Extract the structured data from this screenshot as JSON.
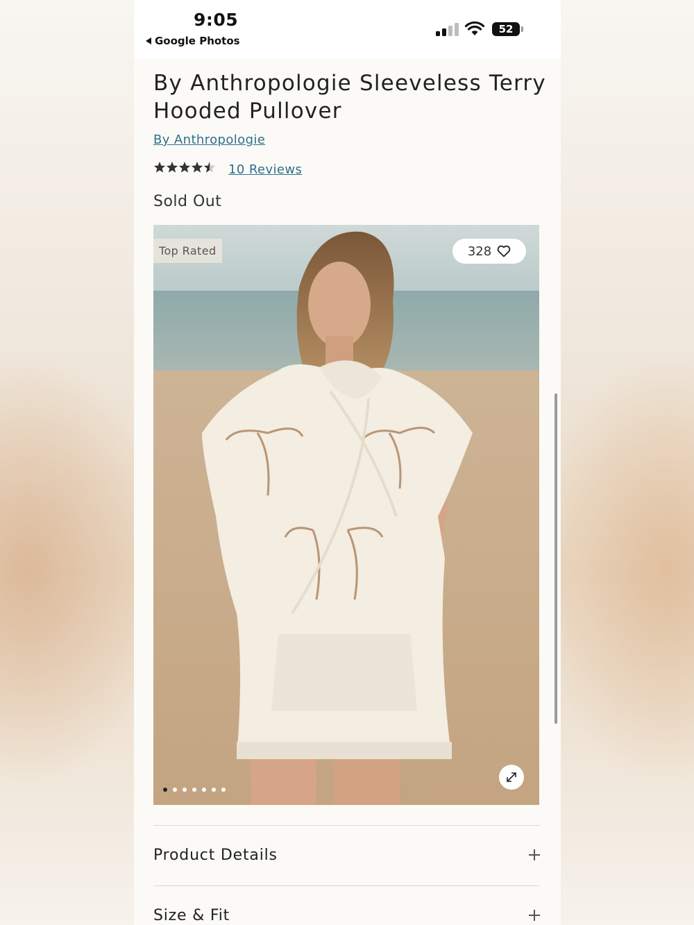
{
  "status_bar": {
    "time": "9:05",
    "back_app": "Google Photos",
    "battery": "52",
    "icons": [
      "back-arrow-icon",
      "signal-icon",
      "wifi-icon",
      "battery-icon"
    ]
  },
  "product": {
    "title": "By Anthropologie Sleeveless Terry Hooded Pullover",
    "brand": "By Anthropologie",
    "rating": 4.5,
    "rating_stars": "★★★★★",
    "reviews": "10 Reviews",
    "availability": "Sold Out"
  },
  "gallery": {
    "badge": "Top Rated",
    "favorites": "328",
    "image_count": 7,
    "active_index": 0,
    "icons": [
      "heart-icon",
      "expand-icon"
    ]
  },
  "accordion": {
    "items": [
      {
        "label": "Product Details"
      },
      {
        "label": "Size & Fit"
      }
    ]
  },
  "colors": {
    "link": "#2f6f8f",
    "text": "#222222",
    "page_bg": "#fbfaf6"
  }
}
